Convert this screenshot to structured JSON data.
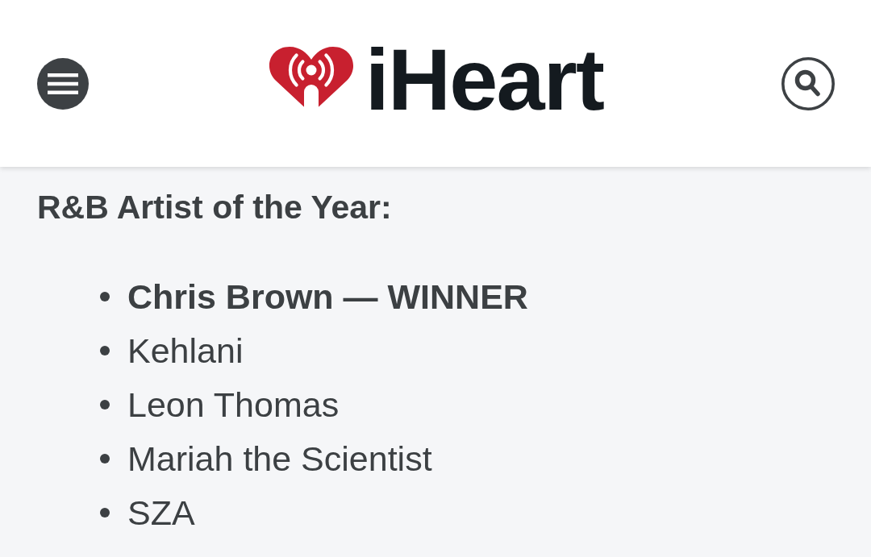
{
  "header": {
    "logo_text": "iHeart"
  },
  "article": {
    "heading": "R&B Artist of the Year:",
    "nominees": [
      {
        "name": "Chris Brown — WINNER",
        "winner": true
      },
      {
        "name": "Kehlani",
        "winner": false
      },
      {
        "name": "Leon Thomas",
        "winner": false
      },
      {
        "name": "Mariah the Scientist",
        "winner": false
      },
      {
        "name": "SZA",
        "winner": false
      }
    ]
  }
}
